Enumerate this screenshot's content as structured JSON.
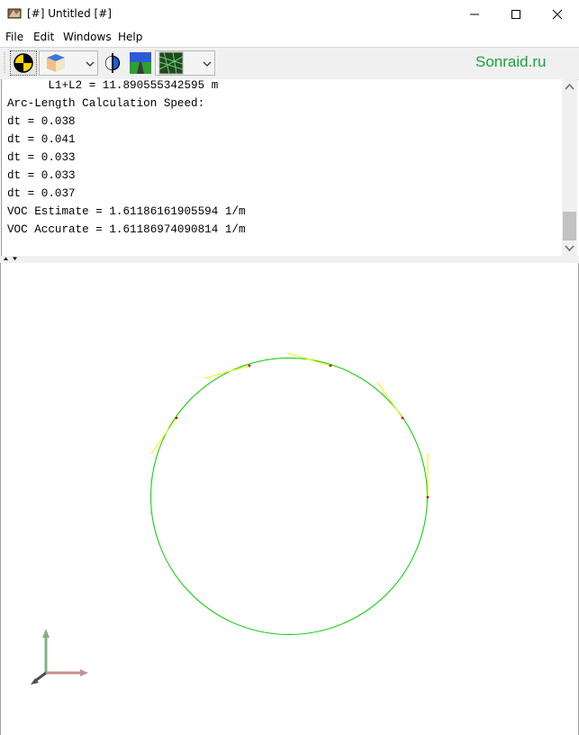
{
  "window": {
    "title": "[#] Untitled [#]",
    "controls": [
      "minimize",
      "maximize",
      "close"
    ]
  },
  "menu": {
    "items": [
      "File",
      "Edit",
      "Windows",
      "Help"
    ]
  },
  "toolbar": {
    "brand_text": "Sonraid.ru",
    "brand_color": "#1aa33b",
    "tools": [
      "crash-test-target-icon",
      "cube-icon",
      "phase-circle-icon",
      "road-icon",
      "grid-view-icon"
    ]
  },
  "console": {
    "lines": [
      "      L1+L2 = 11.890555342595 m",
      "Arc-Length Calculation Speed:",
      "dt = 0.038",
      "dt = 0.041",
      "dt = 0.033",
      "dt = 0.033",
      "dt = 0.037",
      "VOC Estimate = 1.61186161905594 1/m",
      "VOC Accurate = 1.61186974090814 1/m"
    ]
  },
  "viewport": {
    "circle_color": "#00cc00",
    "tangent_color": "#f2f200",
    "point_color": "#cc0000",
    "axis_colors": {
      "x": "#c89090",
      "y": "#80b080",
      "z": "#505050"
    }
  }
}
